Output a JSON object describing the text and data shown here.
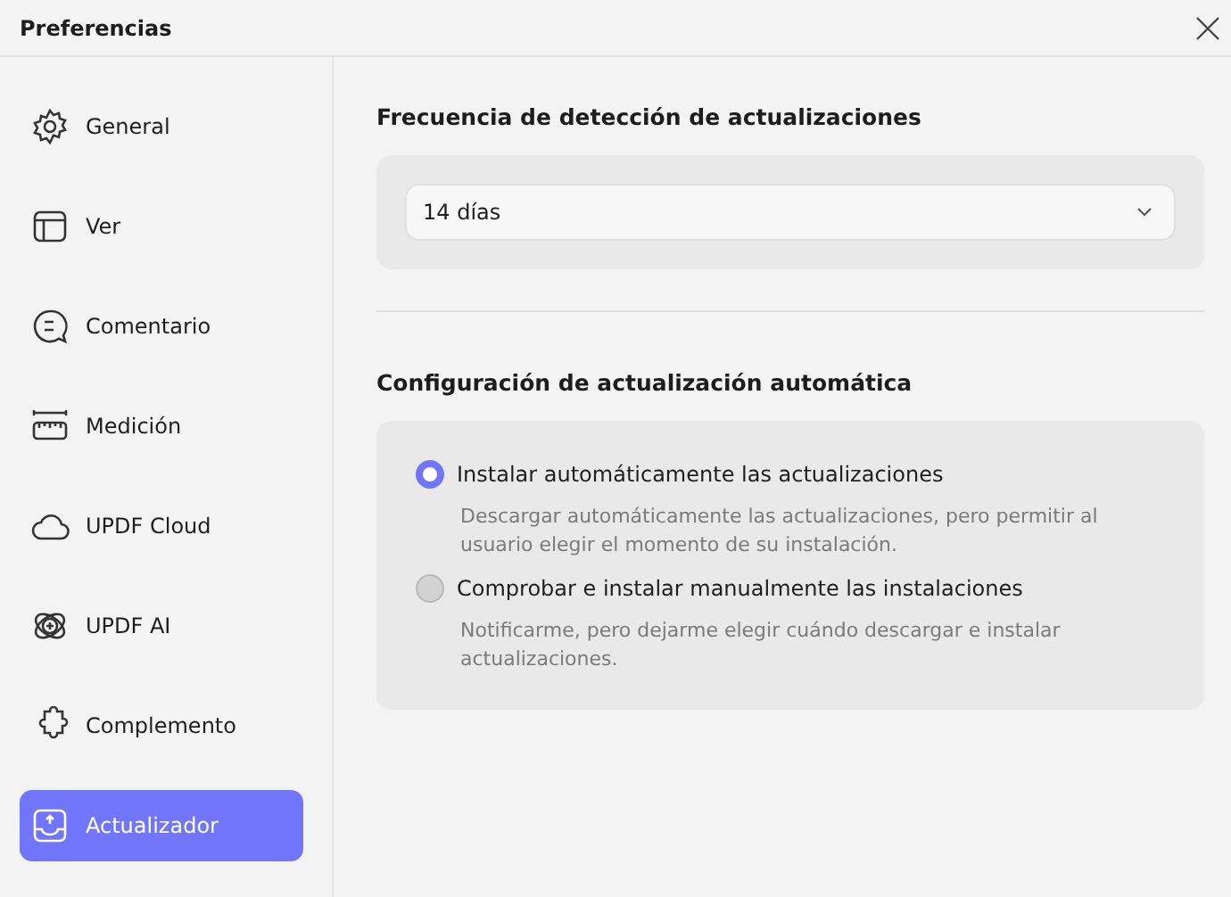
{
  "window": {
    "title": "Preferencias"
  },
  "sidebar": {
    "items": [
      {
        "label": "General",
        "selected": false
      },
      {
        "label": "Ver",
        "selected": false
      },
      {
        "label": "Comentario",
        "selected": false
      },
      {
        "label": "Medición",
        "selected": false
      },
      {
        "label": "UPDF Cloud",
        "selected": false
      },
      {
        "label": "UPDF AI",
        "selected": false
      },
      {
        "label": "Complemento",
        "selected": false
      },
      {
        "label": "Actualizador",
        "selected": true
      }
    ]
  },
  "frequency": {
    "heading": "Frecuencia de detección de actualizaciones",
    "dropdown": {
      "value": "14 días"
    }
  },
  "auto_update": {
    "heading": "Configuración de actualización automática",
    "options": [
      {
        "label": "Instalar automáticamente las actualizaciones",
        "description": "Descargar automáticamente las actualizaciones, pero permitir al usuario elegir el momento de su instalación.",
        "selected": true
      },
      {
        "label": "Comprobar e instalar manualmente las instalaciones",
        "description": "Notificarme, pero dejarme elegir cuándo descargar e instalar actualizaciones.",
        "selected": false
      }
    ]
  }
}
